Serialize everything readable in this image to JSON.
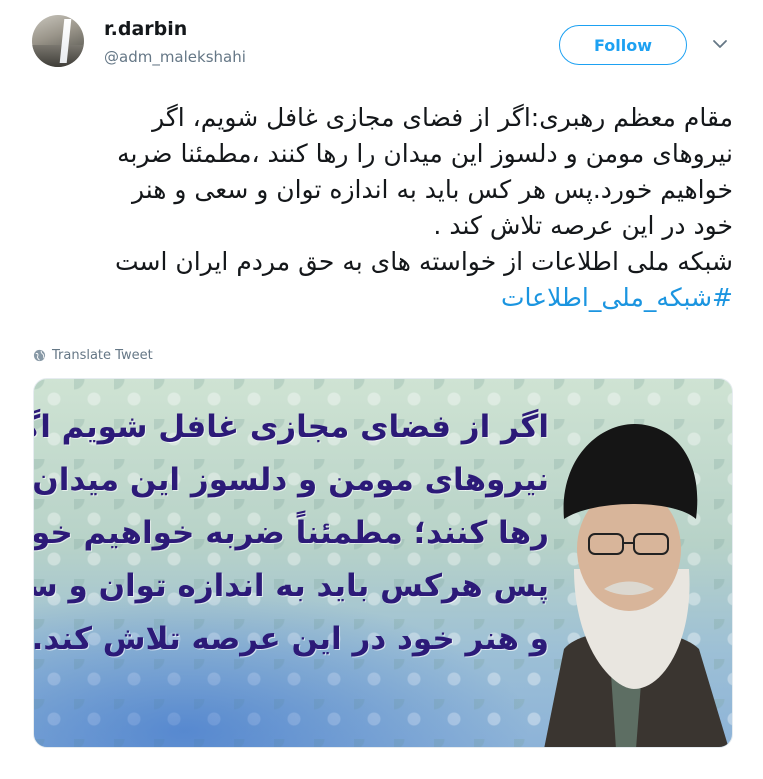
{
  "user": {
    "name": "r.darbin",
    "handle": "@adm_malekshahi"
  },
  "follow_label": "Follow",
  "tweet": {
    "lines": [
      "مقام معظم رهبری:اگر از فضای مجازی غافل شویم، اگر",
      "نیروهای مومن و دلسوز این میدان را رها کنند ،مطمئنا ضربه",
      "خواهیم خورد.پس هر کس باید به اندازه توان و سعی و هنر",
      "خود در این عرصه تلاش کند .",
      "شبکه ملی اطلاعات از خواسته های به حق مردم ایران است"
    ],
    "hashtag": "#شبکه_ملی_اطلاعات"
  },
  "translate_label": "Translate Tweet",
  "media": {
    "quote_lines": [
      "اگر از فضای مجازی غافل شویم اگر",
      "نیروهای مومن و دلسوز این میدان را",
      "رها کنند؛ مطمئناً ضربه خواهیم خورد.",
      "پس هرکس باید به اندازه توان و سعی",
      "و هنر خود در این عرصه تلاش کند."
    ]
  },
  "colors": {
    "accent": "#1da1f2",
    "hashtag": "#1b95e0",
    "muted": "#657786",
    "quote_text": "#2c1a78"
  },
  "icons": {
    "chevron": "chevron-down-icon",
    "globe": "globe-icon"
  }
}
